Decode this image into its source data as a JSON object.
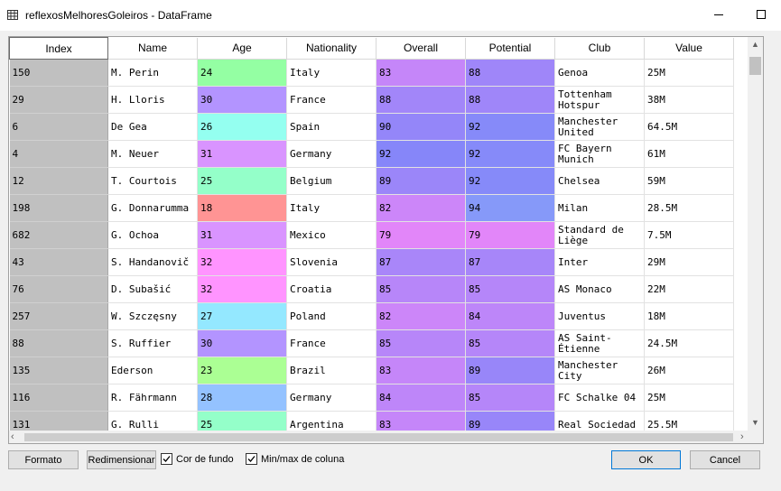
{
  "window": {
    "title": "reflexosMelhoresGoleiros - DataFrame"
  },
  "table": {
    "columns": [
      "Index",
      "Name",
      "Age",
      "Nationality",
      "Overall",
      "Potential",
      "Club",
      "Value"
    ],
    "rows": [
      {
        "index": "150",
        "name": "M. Perin",
        "age": "24",
        "nationality": "Italy",
        "overall": "83",
        "potential": "88",
        "club": "Genoa",
        "value": "25M"
      },
      {
        "index": "29",
        "name": "H. Lloris",
        "age": "30",
        "nationality": "France",
        "overall": "88",
        "potential": "88",
        "club": "Tottenham Hotspur",
        "value": "38M"
      },
      {
        "index": "6",
        "name": "De Gea",
        "age": "26",
        "nationality": "Spain",
        "overall": "90",
        "potential": "92",
        "club": "Manchester United",
        "value": "64.5M"
      },
      {
        "index": "4",
        "name": "M. Neuer",
        "age": "31",
        "nationality": "Germany",
        "overall": "92",
        "potential": "92",
        "club": "FC Bayern Munich",
        "value": "61M"
      },
      {
        "index": "12",
        "name": "T. Courtois",
        "age": "25",
        "nationality": "Belgium",
        "overall": "89",
        "potential": "92",
        "club": "Chelsea",
        "value": "59M"
      },
      {
        "index": "198",
        "name": "G. Donnarumma",
        "age": "18",
        "nationality": "Italy",
        "overall": "82",
        "potential": "94",
        "club": "Milan",
        "value": "28.5M"
      },
      {
        "index": "682",
        "name": "G. Ochoa",
        "age": "31",
        "nationality": "Mexico",
        "overall": "79",
        "potential": "79",
        "club": "Standard de Liège",
        "value": "7.5M"
      },
      {
        "index": "43",
        "name": "S. Handanovič",
        "age": "32",
        "nationality": "Slovenia",
        "overall": "87",
        "potential": "87",
        "club": "Inter",
        "value": "29M"
      },
      {
        "index": "76",
        "name": "D. Subašić",
        "age": "32",
        "nationality": "Croatia",
        "overall": "85",
        "potential": "85",
        "club": "AS Monaco",
        "value": "22M"
      },
      {
        "index": "257",
        "name": "W. Szczęsny",
        "age": "27",
        "nationality": "Poland",
        "overall": "82",
        "potential": "84",
        "club": "Juventus",
        "value": "18M"
      },
      {
        "index": "88",
        "name": "S. Ruffier",
        "age": "30",
        "nationality": "France",
        "overall": "85",
        "potential": "85",
        "club": "AS Saint-Étienne",
        "value": "24.5M"
      },
      {
        "index": "135",
        "name": "Ederson",
        "age": "23",
        "nationality": "Brazil",
        "overall": "83",
        "potential": "89",
        "club": "Manchester City",
        "value": "26M"
      },
      {
        "index": "116",
        "name": "R. Fährmann",
        "age": "28",
        "nationality": "Germany",
        "overall": "84",
        "potential": "85",
        "club": "FC Schalke 04",
        "value": "25M"
      },
      {
        "index": "131",
        "name": "G. Rulli",
        "age": "25",
        "nationality": "Argentina",
        "overall": "83",
        "potential": "89",
        "club": "Real Sociedad",
        "value": "25.5M"
      }
    ]
  },
  "footer": {
    "format_label": "Formato",
    "resize_label": "Redimensionar",
    "bgcolor_label": "Cor de fundo",
    "bgcolor_checked": true,
    "minmax_label": "Min/max de coluna",
    "minmax_checked": true,
    "ok_label": "OK",
    "cancel_label": "Cancel"
  },
  "icons": {
    "app": "table-grid-icon",
    "minimize": "minimize-icon",
    "maximize": "maximize-icon",
    "close": "close-icon",
    "scroll_up": "chevron-up-icon",
    "scroll_down": "chevron-down-icon",
    "scroll_left": "chevron-left-icon",
    "scroll_right": "chevron-right-icon",
    "check": "checkmark-icon"
  }
}
